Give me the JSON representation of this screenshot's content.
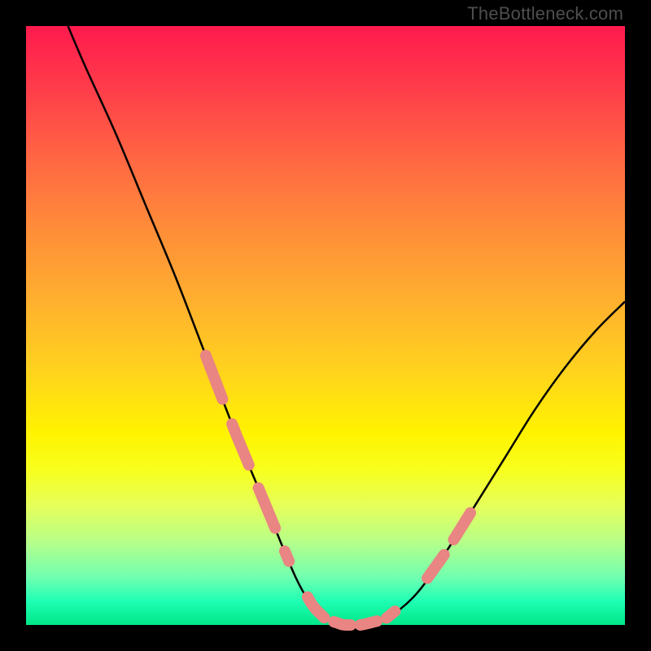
{
  "attribution": "TheBottleneck.com",
  "chart_data": {
    "type": "line",
    "title": "",
    "xlabel": "",
    "ylabel": "",
    "xlim": [
      0,
      100
    ],
    "ylim": [
      0,
      100
    ],
    "series": [
      {
        "name": "bottleneck-curve",
        "x": [
          7,
          10,
          15,
          20,
          25,
          30,
          35,
          40,
          45,
          48,
          50,
          53,
          56,
          60,
          65,
          70,
          75,
          80,
          85,
          90,
          95,
          100
        ],
        "y": [
          100,
          93,
          82,
          70,
          58,
          45,
          32,
          20,
          8,
          3,
          1,
          0,
          0,
          1,
          5,
          12,
          20,
          28,
          36,
          43,
          49,
          54
        ]
      }
    ],
    "markers": [
      {
        "name": "left-cluster",
        "x_range": [
          30,
          44
        ],
        "style": "salmon-dash"
      },
      {
        "name": "bottom-cluster",
        "x_range": [
          47,
          62
        ],
        "style": "salmon-dash"
      },
      {
        "name": "right-cluster",
        "x_range": [
          67,
          76
        ],
        "style": "salmon-dash"
      }
    ],
    "colors": {
      "curve": "#000000",
      "marker": "#e98582",
      "gradient_top": "#ff1a4d",
      "gradient_bottom": "#00e688"
    }
  }
}
